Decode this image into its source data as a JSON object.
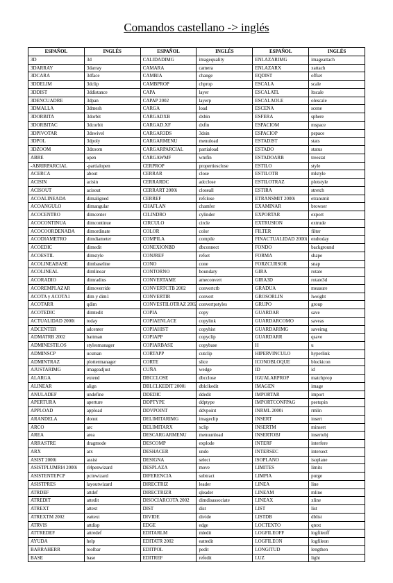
{
  "title": "Comandos castellano -> inglés",
  "headers": [
    "ESPAÑOL",
    "INGLÉS",
    "ESPAÑOL",
    "INGLÉS",
    "ESPAÑOL",
    "INGLÉS"
  ],
  "rows": [
    [
      "3D",
      "3d",
      "CALIDADIMG",
      "imagequality",
      "ENLAZARIMG",
      "imageattach"
    ],
    [
      "3DARRAY",
      "3darray",
      "CAMARA",
      "camera",
      "ENLAZARX",
      "xattach"
    ],
    [
      "3DCARA",
      "3dface",
      "CAMBIA",
      "change",
      "EQDIST",
      "offset"
    ],
    [
      "3DDELIM",
      "3dclip",
      "CAMBPROP",
      "chprop",
      "ESCALA",
      "scale"
    ],
    [
      "3DDIST",
      "3ddistance",
      "CAPA",
      "layer",
      "ESCALATL",
      "ltscale"
    ],
    [
      "3DENCUADRE",
      "3dpan",
      "CAPAP 2002",
      "layerp",
      "ESCALAOLE",
      "olescale"
    ],
    [
      "3DMALLA",
      "3dmesh",
      "CARGA",
      "load",
      "ESCENA",
      "scene"
    ],
    [
      "3DORBITA",
      "3dorbit",
      "CARGADXB",
      "dxbin",
      "ESFERA",
      "sphere"
    ],
    [
      "3DORBITAC",
      "3dcorbit",
      "CARGAD.XF",
      "dxfin",
      "ESPACIOM",
      "mspace"
    ],
    [
      "3DPIVOTAR",
      "3dswivel",
      "CARGAR3DS",
      "3dsin",
      "ESPACIOP",
      "pspace"
    ],
    [
      "3DPOL",
      "3dpoly",
      "CARGARMENU",
      "menuload",
      "ESTADIST",
      "stats"
    ],
    [
      "3DZOOM",
      "3dzoom",
      "CARGARPARCIAL",
      "partiaload",
      "ESTADO",
      "status"
    ],
    [
      "ABRE",
      "open",
      "CARGAWMF",
      "wmfin",
      "ESTADOARB",
      "treestat"
    ],
    [
      "-ABRIRPARCIAL",
      "-partialopen",
      "CERPROP",
      "propertiesclose",
      "ESTILO",
      "style"
    ],
    [
      "ACERCA",
      "about",
      "CERRAR",
      "close",
      "ESTILOTB",
      "mlstyle"
    ],
    [
      "ACISIN",
      "acisin",
      "CERRARDC",
      "adcclose",
      "ESTILOTRAZ",
      "plotstyle"
    ],
    [
      "ACISOUT",
      "acisout",
      "CERRART 2000i",
      "closeall",
      "ESTIRA",
      "stretch"
    ],
    [
      "ACOALINEADA",
      "dimaligned",
      "CERREF",
      "refclose",
      "ETRANSMIT 2000i",
      "etransmit"
    ],
    [
      "ACOANGULO",
      "dimangular",
      "CHAFLAN",
      "chamfer",
      "EXAMINAR",
      "browser"
    ],
    [
      "ACOCENTRO",
      "dimcenter",
      "CILINDRO",
      "cylinder",
      "EXPORTAR",
      "export"
    ],
    [
      "ACOCONTINUA",
      "dimcontinue",
      "CIRCULO",
      "circle",
      "EXTRUSION",
      "extrude"
    ],
    [
      "ACOCOORDENADA",
      "dimordinate",
      "COLOR",
      "color",
      "FILTER",
      "filter"
    ],
    [
      "ACODIAMETRO",
      "dimdiameter",
      "COMPILA",
      "compile",
      "FINACTUALIDAD 2000i",
      "endtoday"
    ],
    [
      "ACOEDIC",
      "dimedit",
      "CONEXIONBD",
      "dbconnect",
      "FONDO",
      "background"
    ],
    [
      "ACOESTIL",
      "dimstyle",
      "CONJREF",
      "refset",
      "FORMA",
      "shape"
    ],
    [
      "ACOLINEABASE",
      "dimbaseline",
      "CONO",
      "cone",
      "FORZCURSOR",
      "snap"
    ],
    [
      "ACOLINEAL",
      "dimlinear",
      "CONTORNO",
      "boundary",
      "GIRA",
      "rotate"
    ],
    [
      "ACORADIO",
      "dimradius",
      "CONVERTAME",
      "ameconvert",
      "GIRA3D",
      "rotate3d"
    ],
    [
      "ACOREMPLAZAR",
      "dimoverride",
      "CONVERTCTB 2002",
      "convertctb",
      "GRADUA",
      "measure"
    ],
    [
      "ACOTA y ACOTA1",
      "dim y dim1",
      "CONVERTIR",
      "convert",
      "GROSORLIN",
      "lweight"
    ],
    [
      "ACOTARR",
      "qdim",
      "CONVESTILOTRAZ 2002",
      "convertpstyles",
      "GRUPO",
      "group"
    ],
    [
      "ACOTEDIC",
      "dimtedit",
      "COPIA",
      "copy",
      "GUARDAR",
      "save"
    ],
    [
      "ACTUALIDAD 2000i",
      "today",
      "COPIAENLACE",
      "copylink",
      "GUARDARCOMO",
      "saveas"
    ],
    [
      "ADCENTER",
      "adcenter",
      "COPIAHIST",
      "copyhist",
      "GUARDARIMG",
      "saveimg"
    ],
    [
      "ADMATRB 2002",
      "battman",
      "COPIAPP",
      "copyclip",
      "GUARDARR",
      "qsave"
    ],
    [
      "ADMINESTILOS",
      "stylesmanager",
      "COPIARBASE",
      "copybase",
      "H",
      "u"
    ],
    [
      "ADMINSCP",
      "ucsman",
      "CORTAPP",
      "cutclip",
      "HIPERVINCULO",
      "hyperlink"
    ],
    [
      "ADMINTRAZ",
      "plottermanager",
      "CORTE",
      "slice",
      "ICONOBLOQUE",
      "blockicon"
    ],
    [
      "AJUSTARIMG",
      "imageadjust",
      "CUÑA",
      "wedge",
      "ID",
      "id"
    ],
    [
      "ALARGA",
      "extend",
      "DBCCLOSE",
      "dbcclose",
      "IGUALARPROP",
      "matchprop"
    ],
    [
      "ALINEAR",
      "align",
      "DBLCLKEDIT 2000i",
      "dblclkedit",
      "IMAGEN",
      "image"
    ],
    [
      "ANULADEF",
      "undefine",
      "DDEDIC",
      "ddedit",
      "IMPORTAR",
      "import"
    ],
    [
      "APERTURA",
      "aperture",
      "DDPTYPE",
      "ddptype",
      "IMPORTCONFPAG",
      "psetupin"
    ],
    [
      "APPLOAD",
      "appload",
      "DDVPOINT",
      "ddvpoint",
      "INRML 2000i",
      "rmlin"
    ],
    [
      "ARANDELA",
      "donut",
      "DELIMITARIMG",
      "imageclip",
      "INSERT",
      "insert"
    ],
    [
      "ARCO",
      "arc",
      "DELIMITARX",
      "xclip",
      "INSERTM",
      "minsert"
    ],
    [
      "AREA",
      "area",
      "DESCARGARMENU",
      "menuunload",
      "INSERTOBJ",
      "insertobj"
    ],
    [
      "ARRASTRE",
      "dragmode",
      "DESCOMP",
      "explode",
      "INTERF",
      "interfere"
    ],
    [
      "ARX",
      "arx",
      "DESHACER",
      "undo",
      "INTERSEC",
      "intersect"
    ],
    [
      "ASIST 2000i",
      "assist",
      "DESIGNA",
      "select",
      "ISOPLANO",
      "isoplane"
    ],
    [
      "ASISTPLUMRI4 2000i",
      "rl4penwizard",
      "DESPLAZA",
      "move",
      "LIMITES",
      "limits"
    ],
    [
      "ASISTENTEPCP",
      "pcinwizard",
      "DIFERENCIA",
      "subtract",
      "LIMPIA",
      "purge"
    ],
    [
      "ASISTPRES",
      "layoutwizard",
      "DIRECTRIZ",
      "leader",
      "LINEA",
      "line"
    ],
    [
      "ATRDEF",
      "attdef",
      "DIRECTRIZR",
      "qleader",
      "LINEAM",
      "mline"
    ],
    [
      "ATREDIT",
      "attedit",
      "DISOCIARCOTA 2002",
      "dimdisassociate",
      "LINEAX",
      "xline"
    ],
    [
      "ATREXT",
      "attext",
      "DIST",
      "dist",
      "LIST",
      "list"
    ],
    [
      "ATREXTM 2002",
      "eattext",
      "DIVIDE",
      "divide",
      "LISTDB",
      "dblist"
    ],
    [
      "ATRVIS",
      "attdisp",
      "EDGE",
      "edge",
      "LOCTEXTO",
      "qtext"
    ],
    [
      "ATTREDEF",
      "attredef",
      "EDITARLM",
      "mledit",
      "LOGFILEOFF",
      "logfileoff"
    ],
    [
      "AYUDA",
      "help",
      "EDITATR 2002",
      "eattedit",
      "LOGFILEON",
      "logfileon"
    ],
    [
      "BARRAHERR",
      "toolbar",
      "EDITPOL",
      "pedit",
      "LONGITUD",
      "lengthen"
    ],
    [
      "BASE",
      "base",
      "EDITREF",
      "refedit",
      "LUZ",
      "light"
    ]
  ]
}
